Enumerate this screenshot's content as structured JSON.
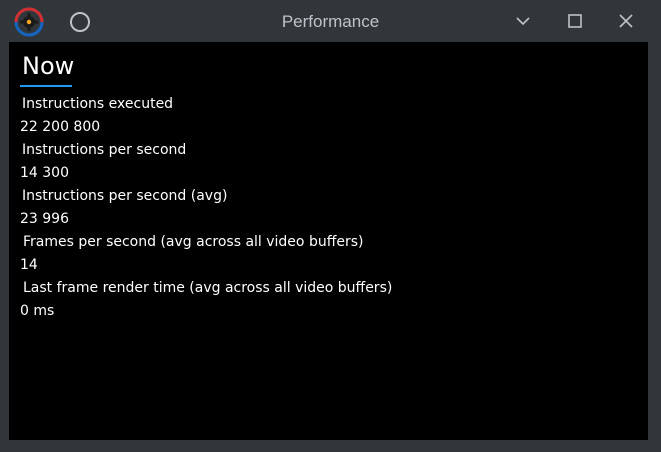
{
  "window": {
    "title": "Performance",
    "buttons": {
      "minimize": "minimize",
      "maximize": "maximize",
      "close": "close"
    }
  },
  "tab": {
    "label": "Now",
    "accent": "#1d99f3"
  },
  "metrics": [
    {
      "label": "Instructions executed",
      "value": "22 200 800"
    },
    {
      "label": "Instructions per second",
      "value": "14 300"
    },
    {
      "label": "Instructions per second (avg)",
      "value": "23 996"
    },
    {
      "label": "Frames per second (avg across all video buffers)",
      "value": "14"
    },
    {
      "label": "Last frame render time (avg across all video buffers)",
      "value": "0 ms"
    }
  ],
  "colors": {
    "titlebar": "#31363b",
    "content_bg": "#000000",
    "text": "#ffffff",
    "title_text": "#bdc3c7"
  },
  "icons": {
    "app": "app-gear-icon",
    "on_all_desktops": "circle-icon",
    "minimize": "minimize-icon",
    "maximize": "maximize-icon",
    "close": "close-icon"
  }
}
